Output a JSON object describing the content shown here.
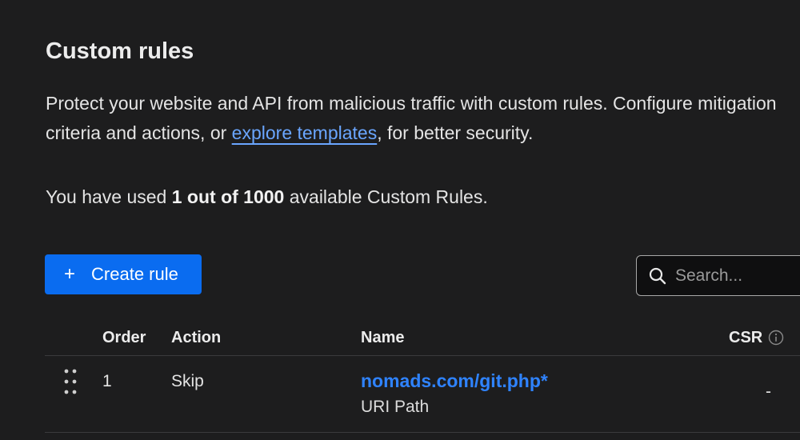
{
  "header": {
    "title": "Custom rules"
  },
  "description": {
    "before_link": "Protect your website and API from malicious traffic with custom rules. Configure mitigation criteria and actions, or ",
    "link_text": "explore templates",
    "after_link": ", for better security."
  },
  "usage": {
    "prefix": "You have used ",
    "count": "1 out of 1000",
    "suffix": " available Custom Rules."
  },
  "toolbar": {
    "create_label": "Create rule",
    "create_icon": "plus-icon",
    "search_placeholder": "Search...",
    "search_value": "",
    "search_icon": "search-icon"
  },
  "table": {
    "columns": {
      "order": "Order",
      "action": "Action",
      "name": "Name",
      "csr": "CSR"
    },
    "csr_info_icon": "info-icon",
    "rows": [
      {
        "order": "1",
        "action": "Skip",
        "name": "nomads.com/git.php*",
        "field": "URI Path",
        "csr": "-"
      }
    ]
  },
  "colors": {
    "background": "#1d1d1e",
    "primary_button": "#0a6cf0",
    "link": "#2f83ff",
    "inline_link": "#6aa6ff"
  }
}
